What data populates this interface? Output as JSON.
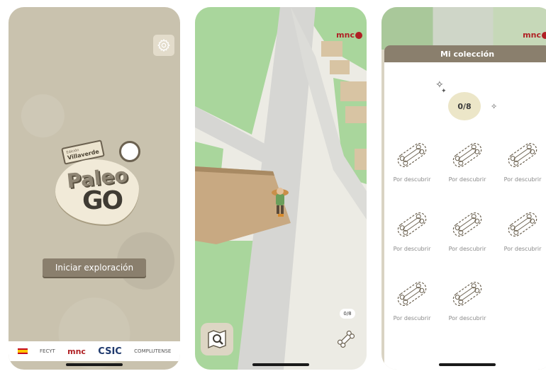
{
  "colors": {
    "brand_brown": "#8a7f6d",
    "mnc_red": "#b02024",
    "map_green": "#a9d69c",
    "map_road": "#d6d6d3",
    "building": "#c8a982",
    "badge": "#ece6c8"
  },
  "welcome": {
    "edition_small": "Edición",
    "edition_name": "Villaverde",
    "logo_line1": "Paleo",
    "logo_line2": "GO",
    "start_button": "Iniciar exploración",
    "settings_icon": "gear-icon",
    "sponsors": [
      "FECYT",
      "mnc",
      "CSIC",
      "COMPLUTENSE"
    ]
  },
  "map": {
    "mnc_label": "mnc",
    "counter": "0/8",
    "fossil_icon": "bone-icon",
    "map_icon": "map-search-icon"
  },
  "collection": {
    "title": "Mi colección",
    "progress": "0/8",
    "items": [
      {
        "label": "Por descubrir"
      },
      {
        "label": "Por descubrir"
      },
      {
        "label": "Por descubrir"
      },
      {
        "label": "Por descubrir"
      },
      {
        "label": "Por descubrir"
      },
      {
        "label": "Por descubrir"
      },
      {
        "label": "Por descubrir"
      },
      {
        "label": "Por descubrir"
      }
    ],
    "mnc_label": "mnc"
  }
}
